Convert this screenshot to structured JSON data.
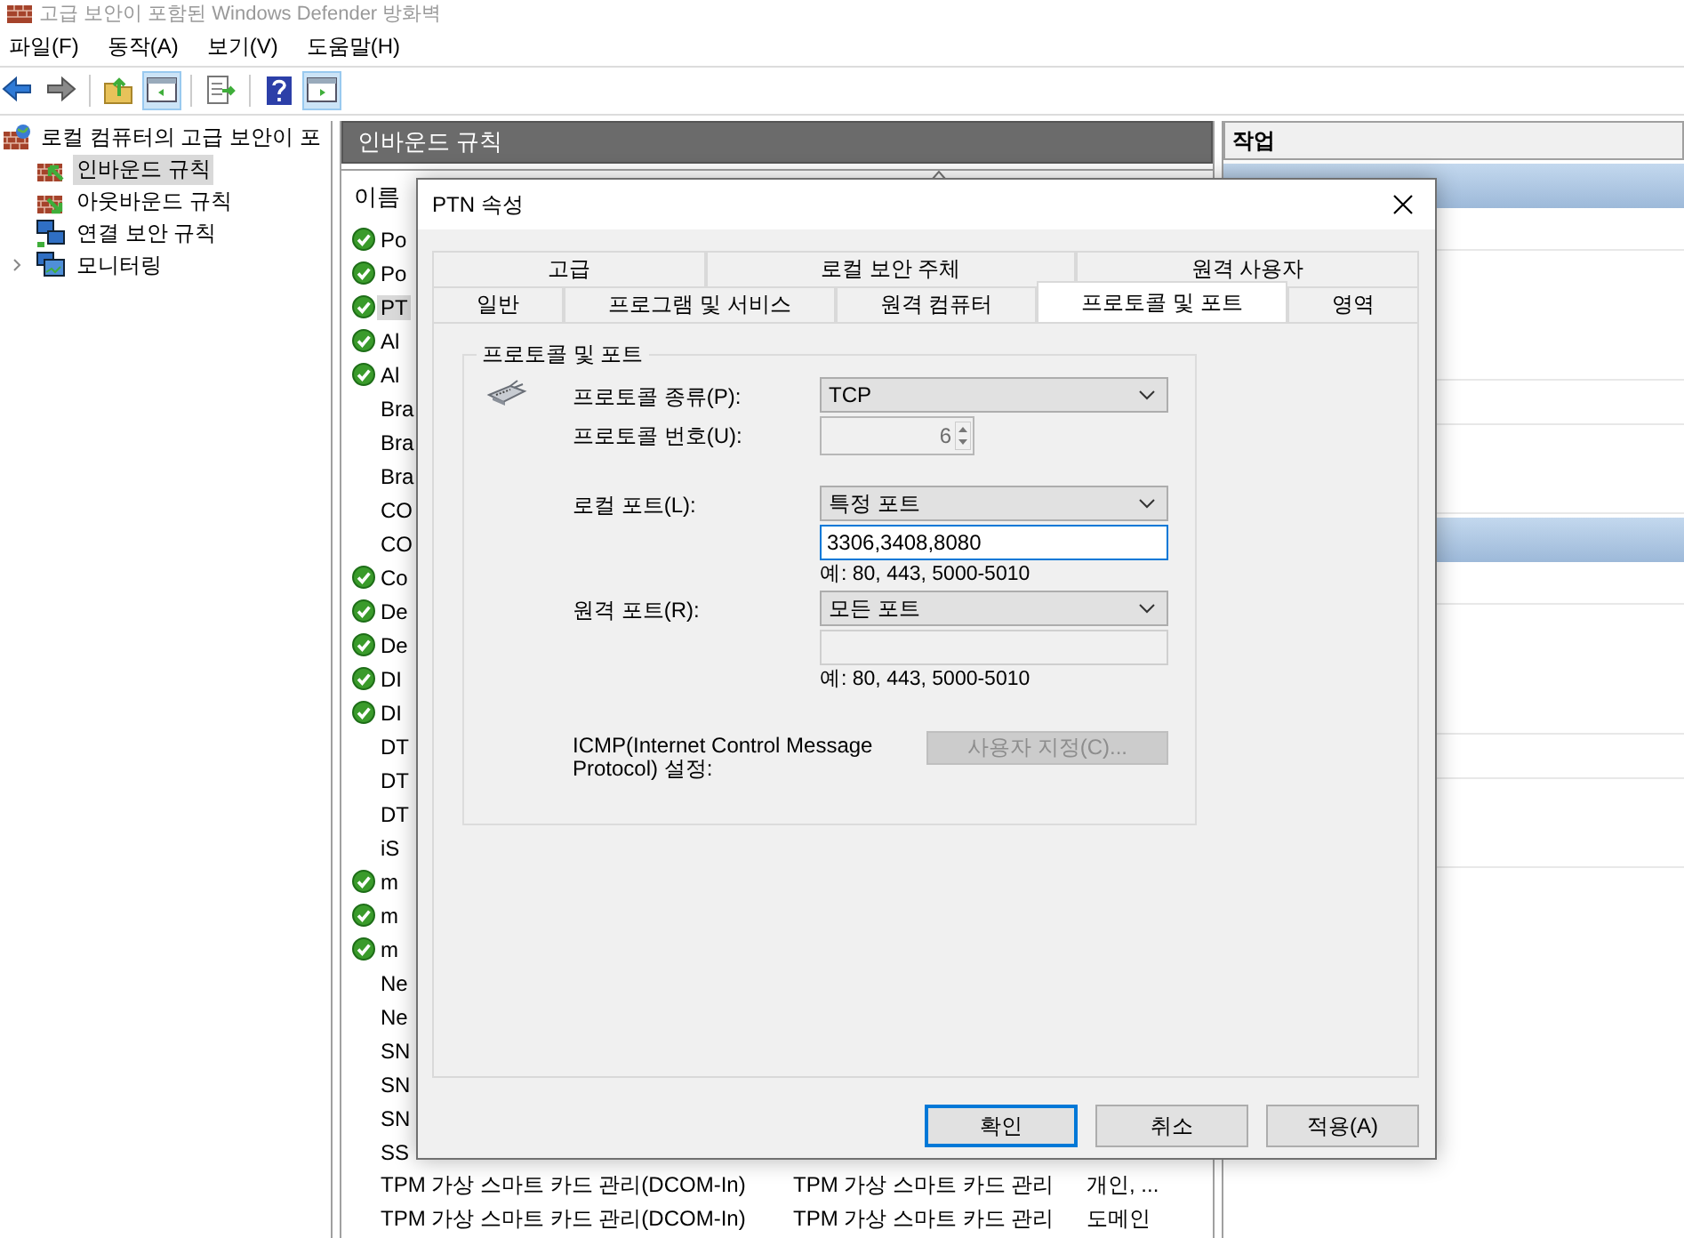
{
  "window": {
    "title": "고급 보안이 포함된 Windows Defender 방화벽"
  },
  "menu": [
    "파일(F)",
    "동작(A)",
    "보기(V)",
    "도움말(H)"
  ],
  "tree": {
    "label": "로컬 컴퓨터의 고급 보안이 포",
    "children": [
      {
        "label": "인바운드 규칙",
        "selected": true
      },
      {
        "label": "아웃바운드 규칙",
        "selected": false
      },
      {
        "label": "연결 보안 규칙",
        "selected": false
      },
      {
        "label": "모니터링",
        "selected": false,
        "expanded": false
      }
    ]
  },
  "rules_panel": {
    "title": "인바운드 규칙",
    "columns": [
      "이름"
    ],
    "rows": [
      {
        "cells": [
          "Po"
        ],
        "enabled": true,
        "selected": false
      },
      {
        "cells": [
          "Po"
        ],
        "enabled": true,
        "selected": false
      },
      {
        "cells": [
          "PT"
        ],
        "enabled": true,
        "selected": true
      },
      {
        "cells": [
          "Al"
        ],
        "enabled": true,
        "selected": false
      },
      {
        "cells": [
          "Al"
        ],
        "enabled": true,
        "selected": false
      },
      {
        "cells": [
          "Bra"
        ],
        "enabled": false,
        "selected": false
      },
      {
        "cells": [
          "Bra"
        ],
        "enabled": false,
        "selected": false
      },
      {
        "cells": [
          "Bra"
        ],
        "enabled": false,
        "selected": false
      },
      {
        "cells": [
          "CO"
        ],
        "enabled": false,
        "selected": false
      },
      {
        "cells": [
          "CO"
        ],
        "enabled": false,
        "selected": false
      },
      {
        "cells": [
          "Co"
        ],
        "enabled": true,
        "selected": false
      },
      {
        "cells": [
          "De"
        ],
        "enabled": true,
        "selected": false
      },
      {
        "cells": [
          "De"
        ],
        "enabled": true,
        "selected": false
      },
      {
        "cells": [
          "DI"
        ],
        "enabled": true,
        "selected": false
      },
      {
        "cells": [
          "DI"
        ],
        "enabled": true,
        "selected": false
      },
      {
        "cells": [
          "DT"
        ],
        "enabled": false,
        "selected": false
      },
      {
        "cells": [
          "DT"
        ],
        "enabled": false,
        "selected": false
      },
      {
        "cells": [
          "DT"
        ],
        "enabled": false,
        "selected": false
      },
      {
        "cells": [
          "iS"
        ],
        "enabled": false,
        "selected": false
      },
      {
        "cells": [
          "m"
        ],
        "enabled": true,
        "selected": false
      },
      {
        "cells": [
          "m"
        ],
        "enabled": true,
        "selected": false
      },
      {
        "cells": [
          "m"
        ],
        "enabled": true,
        "selected": false
      },
      {
        "cells": [
          "Ne"
        ],
        "enabled": false,
        "selected": false
      },
      {
        "cells": [
          "Ne"
        ],
        "enabled": false,
        "selected": false
      },
      {
        "cells": [
          "SN"
        ],
        "enabled": false,
        "selected": false
      },
      {
        "cells": [
          "SN"
        ],
        "enabled": false,
        "selected": false
      },
      {
        "cells": [
          "SN"
        ],
        "enabled": false,
        "selected": false
      },
      {
        "cells": [
          "SS"
        ],
        "enabled": false,
        "selected": false
      },
      {
        "cells": [
          "TPM 가상 스마트 카드 관리(DCOM-In)",
          "TPM 가상 스마트 카드 관리",
          "개인, ..."
        ],
        "enabled": false,
        "selected": false
      },
      {
        "cells": [
          "TPM 가상 스마트 카드 관리(DCOM-In)",
          "TPM 가상 스마트 카드 관리",
          "도메인"
        ],
        "enabled": false,
        "selected": false
      }
    ]
  },
  "actions_panel": {
    "title": "작업"
  },
  "dialog": {
    "title": "PTN 속성",
    "tab_rows": [
      [
        {
          "label": "고급",
          "selected": false
        },
        {
          "label": "로컬 보안 주체",
          "selected": false
        },
        {
          "label": "원격 사용자",
          "selected": false
        }
      ],
      [
        {
          "label": "일반",
          "selected": false
        },
        {
          "label": "프로그램 및 서비스",
          "selected": false
        },
        {
          "label": "원격 컴퓨터",
          "selected": false
        },
        {
          "label": "프로토콜 및 포트",
          "selected": true
        },
        {
          "label": "영역",
          "selected": false
        }
      ]
    ],
    "group": {
      "title": "프로토콜 및 포트",
      "fields": [
        {
          "kind": "select",
          "label": "프로토콜 종류(P):",
          "value": "TCP"
        },
        {
          "kind": "spin",
          "label": "프로토콜 번호(U):",
          "value": "6",
          "disabled": true
        },
        {
          "kind": "select",
          "label": "로컬 포트(L):",
          "value": "특정 포트"
        },
        {
          "kind": "input",
          "value": "3306,3408,8080",
          "focused": true,
          "disabled": false
        },
        {
          "kind": "hint",
          "text": "예: 80, 443, 5000-5010"
        },
        {
          "kind": "select",
          "label": "원격 포트(R):",
          "value": "모든 포트"
        },
        {
          "kind": "input",
          "focused": false,
          "disabled": true
        },
        {
          "kind": "hint",
          "text": "예: 80, 443, 5000-5010"
        },
        {
          "kind": "button",
          "label": "ICMP(Internet Control Message Protocol) 설정:",
          "button": "사용자 지정(C)...",
          "disabled": true
        }
      ]
    },
    "buttons": [
      {
        "label": "확인",
        "default": true
      },
      {
        "label": "취소",
        "default": false
      },
      {
        "label": "적용(A)",
        "default": false
      }
    ]
  }
}
